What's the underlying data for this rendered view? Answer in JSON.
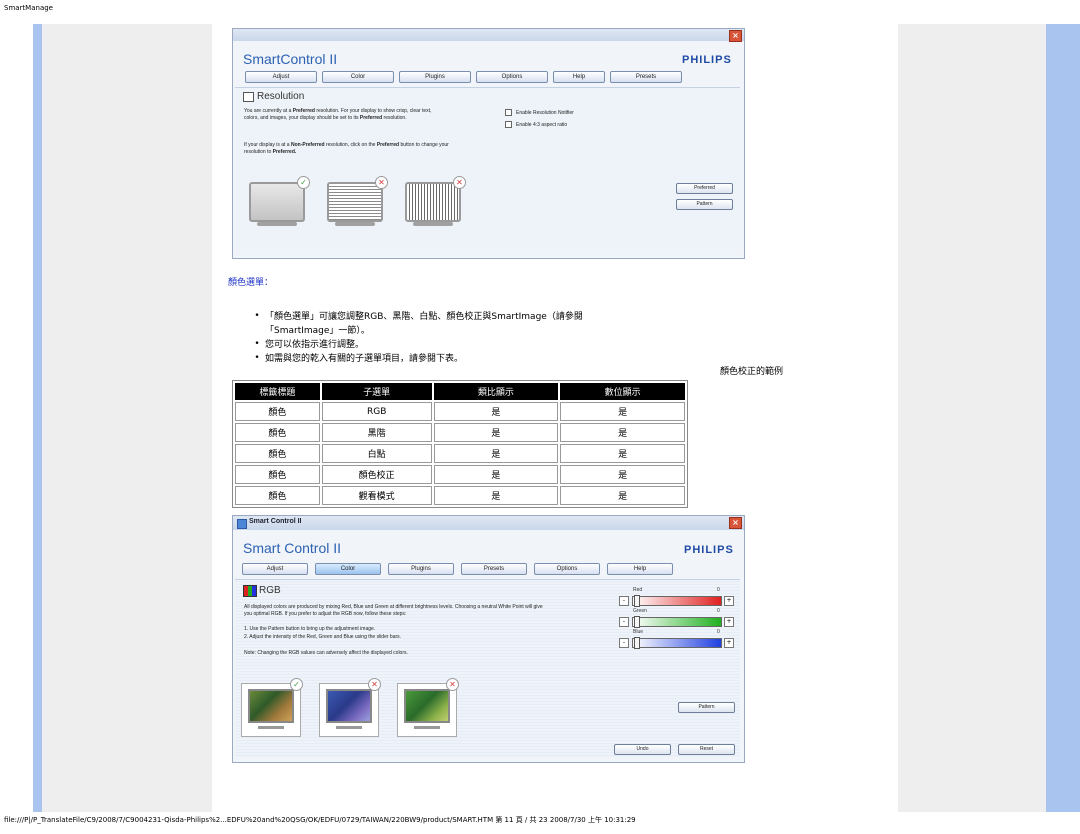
{
  "page": {
    "header_label": "SmartManage",
    "footer_path": "file:///P|/P_TranslateFile/C9/2008/7/C9004231-Qisda-Philips%2...EDFU%20and%20QSG/OK/EDFU/0729/TAIWAN/220BW9/product/SMART.HTM 第 11 頁 / 共 23 2008/7/30 上午 10:31:29"
  },
  "window1": {
    "app_title": "SmartControl II",
    "brand": "PHILIPS",
    "close_glyph": "×",
    "tabs": [
      "Adjust",
      "Color",
      "Plugins",
      "Options",
      "Help",
      "Presets"
    ],
    "section_title": "Resolution",
    "para1_a": "You are currently at a ",
    "para1_b": "Preferred",
    "para1_c": " resolution. For your display to show crisp, clear text, colors, and images, your display should be set to its ",
    "para1_d": "Preferred",
    "para1_e": " resolution.",
    "para2_a": "If your display is at a ",
    "para2_b": "Non-Preferred",
    "para2_c": " resolution, click on the ",
    "para2_d": "Preferred",
    "para2_e": " button to change your resolution to ",
    "para2_f": "Preferred.",
    "checkbox1": "Enable Resolution Notifier",
    "checkbox2": "Enable 4:3 aspect ratio",
    "btn_preferred": "Preferred",
    "btn_pattern": "Pattern",
    "badge_ok": "✓",
    "badge_bad": "✕"
  },
  "section": {
    "heading": "顏色選單：",
    "bullets": [
      "「顏色選單」可讓您調整RGB、黑階、白點、顏色校正與SmartImage（請參閱",
      "「SmartImage」一節）。",
      "您可以依指示進行調整。",
      "如需與您的乾入有關的子選單項目，請參閱下表。"
    ],
    "bullet_glyph": "•",
    "side_caption": "顏色校正的範例"
  },
  "table": {
    "headers": [
      "標籤標題",
      "子選單",
      "類比顯示",
      "數位顯示"
    ],
    "rows": [
      [
        "顏色",
        "RGB",
        "是",
        "是"
      ],
      [
        "顏色",
        "黑階",
        "是",
        "是"
      ],
      [
        "顏色",
        "白點",
        "是",
        "是"
      ],
      [
        "顏色",
        "顏色校正",
        "是",
        "是"
      ],
      [
        "顏色",
        "觀看模式",
        "是",
        "是"
      ]
    ]
  },
  "window2": {
    "title_bar": "Smart Control II",
    "app_title": "Smart Control II",
    "brand": "PHILIPS",
    "close_glyph": "×",
    "tabs": [
      "Adjust",
      "Color",
      "Plugins",
      "Presets",
      "Options",
      "Help"
    ],
    "section_title": "RGB",
    "para1": "All displayed colors are produced by mixing Red, Blue and Green at different brightness levels. Choosing a neutral White Point will give you optimal RGB. If you prefer to adjust the RGB now, follow these steps:",
    "step1": "1. Use the Pattern button to bring up the adjustment image.",
    "step2": "2. Adjust the intensity of the Red, Green and Blue using the slider bars.",
    "note": "Note: Changing the RGB values can adversely affect the displayed colors.",
    "sliders": [
      {
        "label": "Red",
        "value": "0",
        "color": "#e02020"
      },
      {
        "label": "Green",
        "value": "0",
        "color": "#20b020"
      },
      {
        "label": "Blue",
        "value": "0",
        "color": "#2040e0"
      }
    ],
    "minus": "-",
    "plus": "+",
    "btn_pattern": "Pattern",
    "btn_undo": "Undo",
    "btn_reset": "Reset",
    "badge_ok": "✓",
    "badge_bad": "✕"
  }
}
